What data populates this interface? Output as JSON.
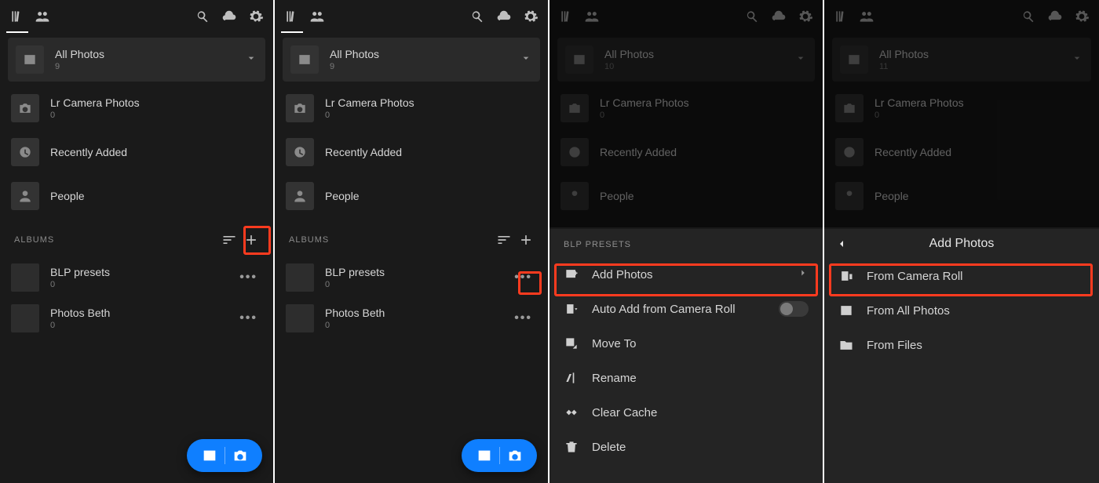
{
  "panes": [
    {
      "allPhotos": {
        "label": "All Photos",
        "count": "9"
      },
      "lrCam": {
        "label": "Lr Camera Photos",
        "count": "0"
      },
      "recent": {
        "label": "Recently Added"
      },
      "people": {
        "label": "People"
      },
      "albumsHeader": "ALBUMS",
      "albums": [
        {
          "title": "BLP presets",
          "count": "0"
        },
        {
          "title": "Photos Beth",
          "count": "0"
        }
      ]
    },
    {
      "allPhotos": {
        "label": "All Photos",
        "count": "9"
      },
      "lrCam": {
        "label": "Lr Camera Photos",
        "count": "0"
      },
      "recent": {
        "label": "Recently Added"
      },
      "people": {
        "label": "People"
      },
      "albumsHeader": "ALBUMS",
      "albums": [
        {
          "title": "BLP presets",
          "count": "0"
        },
        {
          "title": "Photos Beth",
          "count": "0"
        }
      ]
    },
    {
      "allPhotos": {
        "label": "All Photos",
        "count": "10"
      },
      "lrCam": {
        "label": "Lr Camera Photos",
        "count": "0"
      },
      "recent": {
        "label": "Recently Added"
      },
      "people": {
        "label": "People"
      },
      "sheetTitle": "BLP PRESETS",
      "menu": {
        "addPhotos": "Add Photos",
        "autoAdd": "Auto Add from Camera Roll",
        "moveTo": "Move To",
        "rename": "Rename",
        "clearCache": "Clear Cache",
        "delete": "Delete"
      }
    },
    {
      "allPhotos": {
        "label": "All Photos",
        "count": "11"
      },
      "lrCam": {
        "label": "Lr Camera Photos",
        "count": "0"
      },
      "recent": {
        "label": "Recently Added"
      },
      "people": {
        "label": "People"
      },
      "navTitle": "Add Photos",
      "menu": {
        "fromCameraRoll": "From Camera Roll",
        "fromAllPhotos": "From All Photos",
        "fromFiles": "From Files"
      }
    }
  ]
}
